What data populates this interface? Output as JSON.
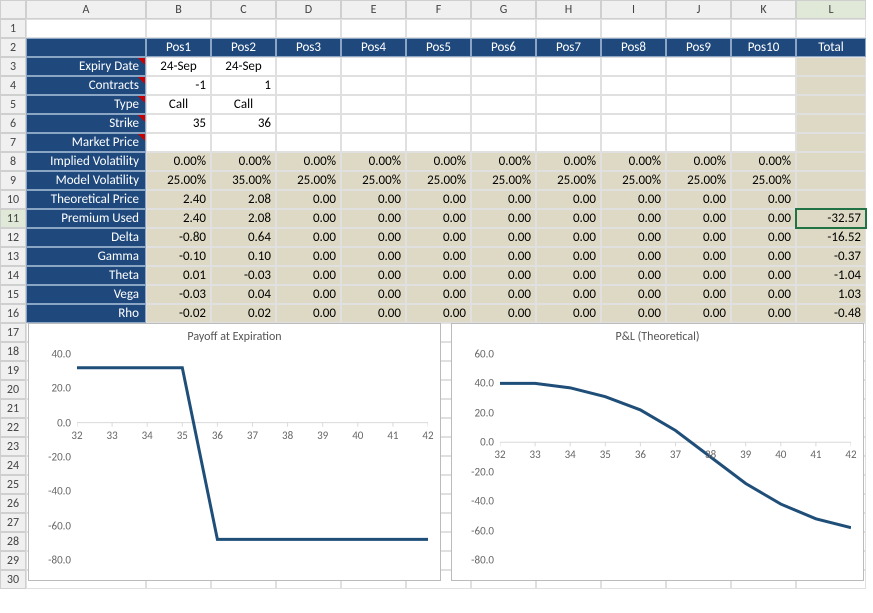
{
  "columns": [
    "A",
    "B",
    "C",
    "D",
    "E",
    "F",
    "G",
    "H",
    "I",
    "J",
    "K",
    "L"
  ],
  "row_count": 30,
  "active_cell": {
    "col": "L",
    "row": 11
  },
  "pos_headers": [
    "Pos1",
    "Pos2",
    "Pos3",
    "Pos4",
    "Pos5",
    "Pos6",
    "Pos7",
    "Pos8",
    "Pos9",
    "Pos10"
  ],
  "total_label": "Total",
  "row_labels": {
    "expiry": "Expiry Date",
    "contracts": "Contracts",
    "type": "Type",
    "strike": "Strike",
    "market": "Market Price",
    "iv": "Implied Volatility",
    "mv": "Model Volatility",
    "tp": "Theoretical Price",
    "pu": "Premium Used",
    "delta": "Delta",
    "gamma": "Gamma",
    "theta": "Theta",
    "vega": "Vega",
    "rho": "Rho"
  },
  "data": {
    "expiry": [
      "24-Sep",
      "24-Sep",
      "",
      "",
      "",
      "",
      "",
      "",
      "",
      ""
    ],
    "contracts": [
      "-1",
      "1",
      "",
      "",
      "",
      "",
      "",
      "",
      "",
      ""
    ],
    "type": [
      "Call",
      "Call",
      "",
      "",
      "",
      "",
      "",
      "",
      "",
      ""
    ],
    "strike": [
      "35",
      "36",
      "",
      "",
      "",
      "",
      "",
      "",
      "",
      ""
    ],
    "market": [
      "",
      "",
      "",
      "",
      "",
      "",
      "",
      "",
      "",
      ""
    ],
    "iv": [
      "0.00%",
      "0.00%",
      "0.00%",
      "0.00%",
      "0.00%",
      "0.00%",
      "0.00%",
      "0.00%",
      "0.00%",
      "0.00%"
    ],
    "mv": [
      "25.00%",
      "35.00%",
      "25.00%",
      "25.00%",
      "25.00%",
      "25.00%",
      "25.00%",
      "25.00%",
      "25.00%",
      "25.00%"
    ],
    "tp": [
      "2.40",
      "2.08",
      "0.00",
      "0.00",
      "0.00",
      "0.00",
      "0.00",
      "0.00",
      "0.00",
      "0.00"
    ],
    "pu": [
      "2.40",
      "2.08",
      "0.00",
      "0.00",
      "0.00",
      "0.00",
      "0.00",
      "0.00",
      "0.00",
      "0.00"
    ],
    "delta": [
      "-0.80",
      "0.64",
      "0.00",
      "0.00",
      "0.00",
      "0.00",
      "0.00",
      "0.00",
      "0.00",
      "0.00"
    ],
    "gamma": [
      "-0.10",
      "0.10",
      "0.00",
      "0.00",
      "0.00",
      "0.00",
      "0.00",
      "0.00",
      "0.00",
      "0.00"
    ],
    "theta": [
      "0.01",
      "-0.03",
      "0.00",
      "0.00",
      "0.00",
      "0.00",
      "0.00",
      "0.00",
      "0.00",
      "0.00"
    ],
    "vega": [
      "-0.03",
      "0.04",
      "0.00",
      "0.00",
      "0.00",
      "0.00",
      "0.00",
      "0.00",
      "0.00",
      "0.00"
    ],
    "rho": [
      "-0.02",
      "0.02",
      "0.00",
      "0.00",
      "0.00",
      "0.00",
      "0.00",
      "0.00",
      "0.00",
      "0.00"
    ]
  },
  "totals": {
    "pu": "-32.57",
    "delta": "-16.52",
    "gamma": "-0.37",
    "theta": "-1.04",
    "vega": "1.03",
    "rho": "-0.48"
  },
  "comment_rows": [
    "expiry",
    "contracts",
    "type",
    "strike",
    "market"
  ],
  "chart_data": [
    {
      "type": "line",
      "title": "Payoff at Expiration",
      "x": [
        32,
        33,
        34,
        35,
        36,
        37,
        38,
        39,
        40,
        41,
        42
      ],
      "values": [
        32,
        32,
        32,
        32,
        -68,
        -68,
        -68,
        -68,
        -68,
        -68,
        -68
      ],
      "xlim": [
        32,
        42
      ],
      "ylim": [
        -80,
        40
      ],
      "yticks": [
        -80,
        -60,
        -40,
        -20,
        0,
        20,
        40
      ],
      "xticks": [
        32,
        33,
        34,
        35,
        36,
        37,
        38,
        39,
        40,
        41,
        42
      ],
      "xaxis_at": 0
    },
    {
      "type": "line",
      "title": "P&L (Theoretical)",
      "x": [
        32,
        33,
        34,
        35,
        36,
        37,
        38,
        39,
        40,
        41,
        42
      ],
      "values": [
        40,
        40,
        37,
        31,
        22,
        8,
        -10,
        -28,
        -42,
        -52,
        -58
      ],
      "xlim": [
        32,
        42
      ],
      "ylim": [
        -80,
        60
      ],
      "yticks": [
        -80,
        -60,
        -40,
        -20,
        0,
        20,
        40,
        60
      ],
      "xticks": [
        32,
        33,
        34,
        35,
        36,
        37,
        38,
        39,
        40,
        41,
        42
      ],
      "xaxis_at": 0
    }
  ]
}
